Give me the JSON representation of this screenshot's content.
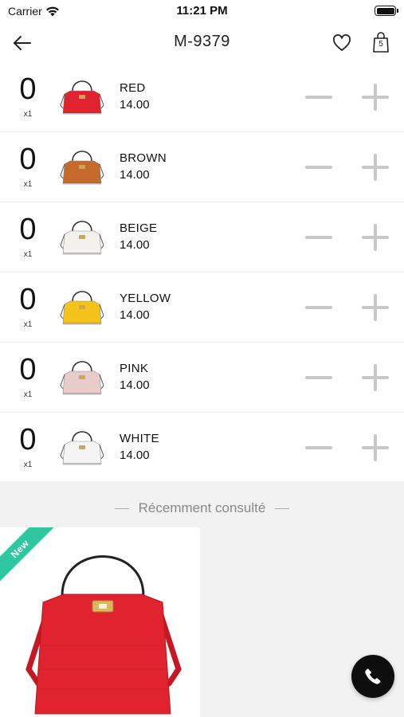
{
  "status_bar": {
    "carrier": "Carrier",
    "time": "11:21 PM"
  },
  "nav": {
    "title": "M-9379",
    "cart_count": "5"
  },
  "variants": [
    {
      "qty": "0",
      "multiplier": "x1",
      "color": "RED",
      "price": "14.00",
      "swatch": "#e0232f"
    },
    {
      "qty": "0",
      "multiplier": "x1",
      "color": "BROWN",
      "price": "14.00",
      "swatch": "#c46a2a"
    },
    {
      "qty": "0",
      "multiplier": "x1",
      "color": "BEIGE",
      "price": "14.00",
      "swatch": "#f3f1ec"
    },
    {
      "qty": "0",
      "multiplier": "x1",
      "color": "YELLOW",
      "price": "14.00",
      "swatch": "#f5c21a"
    },
    {
      "qty": "0",
      "multiplier": "x1",
      "color": "PINK",
      "price": "14.00",
      "swatch": "#e8cccb"
    },
    {
      "qty": "0",
      "multiplier": "x1",
      "color": "WHITE",
      "price": "14.00",
      "swatch": "#f4f4f4"
    }
  ],
  "recent": {
    "title": "Récemment consulté",
    "items": [
      {
        "badge": "New",
        "bag_color": "#e0232f"
      }
    ]
  },
  "colors": {
    "accent_ribbon": "#2ec7a0",
    "button_gray": "#c8c8c8",
    "call_button": "#0e0e0e"
  }
}
